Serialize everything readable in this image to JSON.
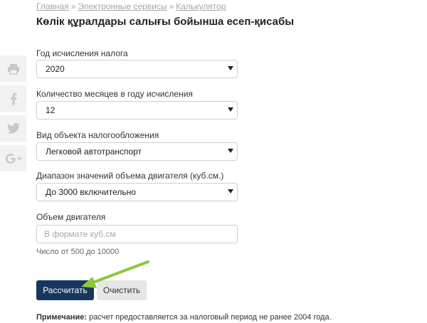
{
  "breadcrumb": {
    "items": [
      "Главная",
      "Электронные сервисы",
      "Калькулятор"
    ],
    "separator": "»"
  },
  "page_title": "Көлік құралдары салығы бойынша есеп-қисабы",
  "share": {
    "icons": [
      "print-icon",
      "facebook-icon",
      "twitter-icon",
      "google-plus-icon"
    ]
  },
  "form": {
    "year": {
      "label": "Год исчисления налога",
      "value": "2020"
    },
    "months": {
      "label": "Количество месяцев в году исчисления",
      "value": "12"
    },
    "object_type": {
      "label": "Вид объекта налогообложения",
      "value": "Легковой автотранспорт"
    },
    "engine_range": {
      "label": "Диапазон значений объема двигателя (куб.см.)",
      "value": "До 3000 включительно"
    },
    "engine_volume": {
      "label": "Объем двигателя",
      "placeholder": "В формате куб.см",
      "value": ""
    },
    "engine_hint": "Число от 500 до 10000"
  },
  "buttons": {
    "calculate": "Рассчитать",
    "clear": "Очистить"
  },
  "note": {
    "label": "Примечание:",
    "text": " расчет предоставляется за налоговый период не ранее 2004 года."
  },
  "colors": {
    "primary_button": "#17375f",
    "annotation_arrow": "#8dc63f"
  }
}
